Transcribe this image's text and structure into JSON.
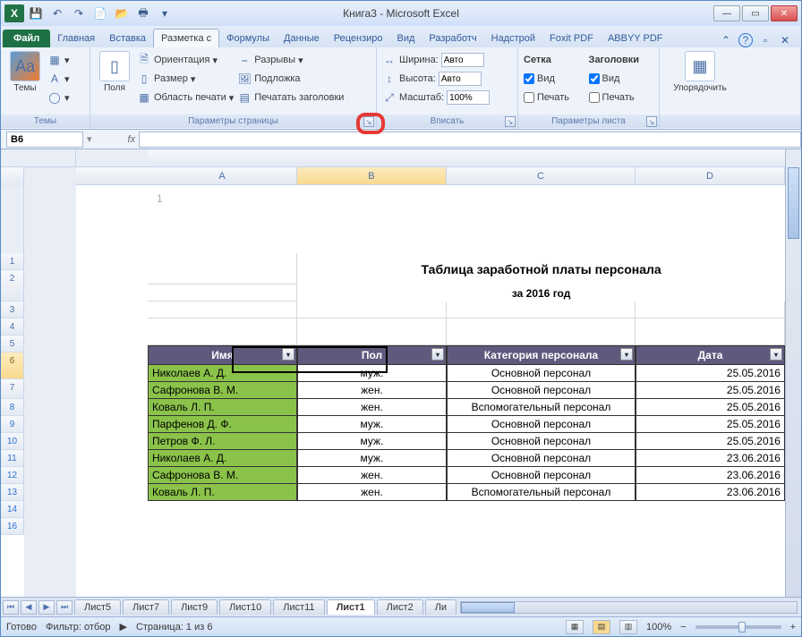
{
  "window": {
    "title": "Книга3 - Microsoft Excel"
  },
  "qat": {
    "excel": "X",
    "save": "💾",
    "undo": "↶",
    "redo": "↷",
    "new": "📄",
    "open": "📂",
    "print": "🖶"
  },
  "tabs": {
    "file": "Файл",
    "items": [
      "Главная",
      "Вставка",
      "Разметка с",
      "Формулы",
      "Данные",
      "Рецензиро",
      "Вид",
      "Разработч",
      "Надстрой",
      "Foxit PDF",
      "ABBYY PDF"
    ],
    "active_index": 2
  },
  "ribbon": {
    "themes": {
      "btn": "Темы",
      "label": "Темы"
    },
    "page_setup": {
      "margins": "Поля",
      "orientation": "Ориентация",
      "size": "Размер",
      "print_area": "Область печати",
      "breaks": "Разрывы",
      "background": "Подложка",
      "print_titles": "Печатать заголовки",
      "label": "Параметры страницы"
    },
    "scale": {
      "width_l": "Ширина:",
      "width_v": "Авто",
      "height_l": "Высота:",
      "height_v": "Авто",
      "scale_l": "Масштаб:",
      "scale_v": "100%",
      "label": "Вписать"
    },
    "sheet_opts": {
      "grid_l": "Сетка",
      "head_l": "Заголовки",
      "view": "Вид",
      "print": "Печать",
      "label": "Параметры листа"
    },
    "arrange": {
      "btn": "Упорядочить",
      "label": ""
    }
  },
  "fbar": {
    "name": "B6",
    "fx": "fx"
  },
  "columns": [
    "A",
    "B",
    "C",
    "D"
  ],
  "page_header_num": "1",
  "table": {
    "title": "Таблица заработной платы персонала",
    "subtitle": "за 2016 год",
    "headers": [
      "Имя",
      "Пол",
      "Категория персонала",
      "Дата"
    ],
    "rows": [
      {
        "n": "8",
        "name": "Николаев А. Д.",
        "sex": "муж.",
        "cat": "Основной персонал",
        "date": "25.05.2016"
      },
      {
        "n": "9",
        "name": "Сафронова В. М.",
        "sex": "жен.",
        "cat": "Основной персонал",
        "date": "25.05.2016"
      },
      {
        "n": "10",
        "name": "Коваль Л. П.",
        "sex": "жен.",
        "cat": "Вспомогательный персонал",
        "date": "25.05.2016"
      },
      {
        "n": "11",
        "name": "Парфенов Д. Ф.",
        "sex": "муж.",
        "cat": "Основной персонал",
        "date": "25.05.2016"
      },
      {
        "n": "12",
        "name": "Петров Ф. Л.",
        "sex": "муж.",
        "cat": "Основной персонал",
        "date": "25.05.2016"
      },
      {
        "n": "13",
        "name": "Николаев А. Д.",
        "sex": "муж.",
        "cat": "Основной персонал",
        "date": "23.06.2016"
      },
      {
        "n": "14",
        "name": "Сафронова В. М.",
        "sex": "жен.",
        "cat": "Основной персонал",
        "date": "23.06.2016"
      },
      {
        "n": "16",
        "name": "Коваль Л. П.",
        "sex": "жен.",
        "cat": "Вспомогательный персонал",
        "date": "23.06.2016"
      }
    ],
    "pre_rows": [
      "1",
      "2",
      "3",
      "4",
      "5",
      "6",
      "7"
    ]
  },
  "sheets": {
    "items": [
      "Лист5",
      "Лист7",
      "Лист9",
      "Лист10",
      "Лист11",
      "Лист1",
      "Лист2",
      "Ли"
    ],
    "active_index": 5
  },
  "status": {
    "ready": "Готово",
    "filter": "Фильтр: отбор",
    "page": "Страница: 1 из 6",
    "zoom": "100%"
  }
}
